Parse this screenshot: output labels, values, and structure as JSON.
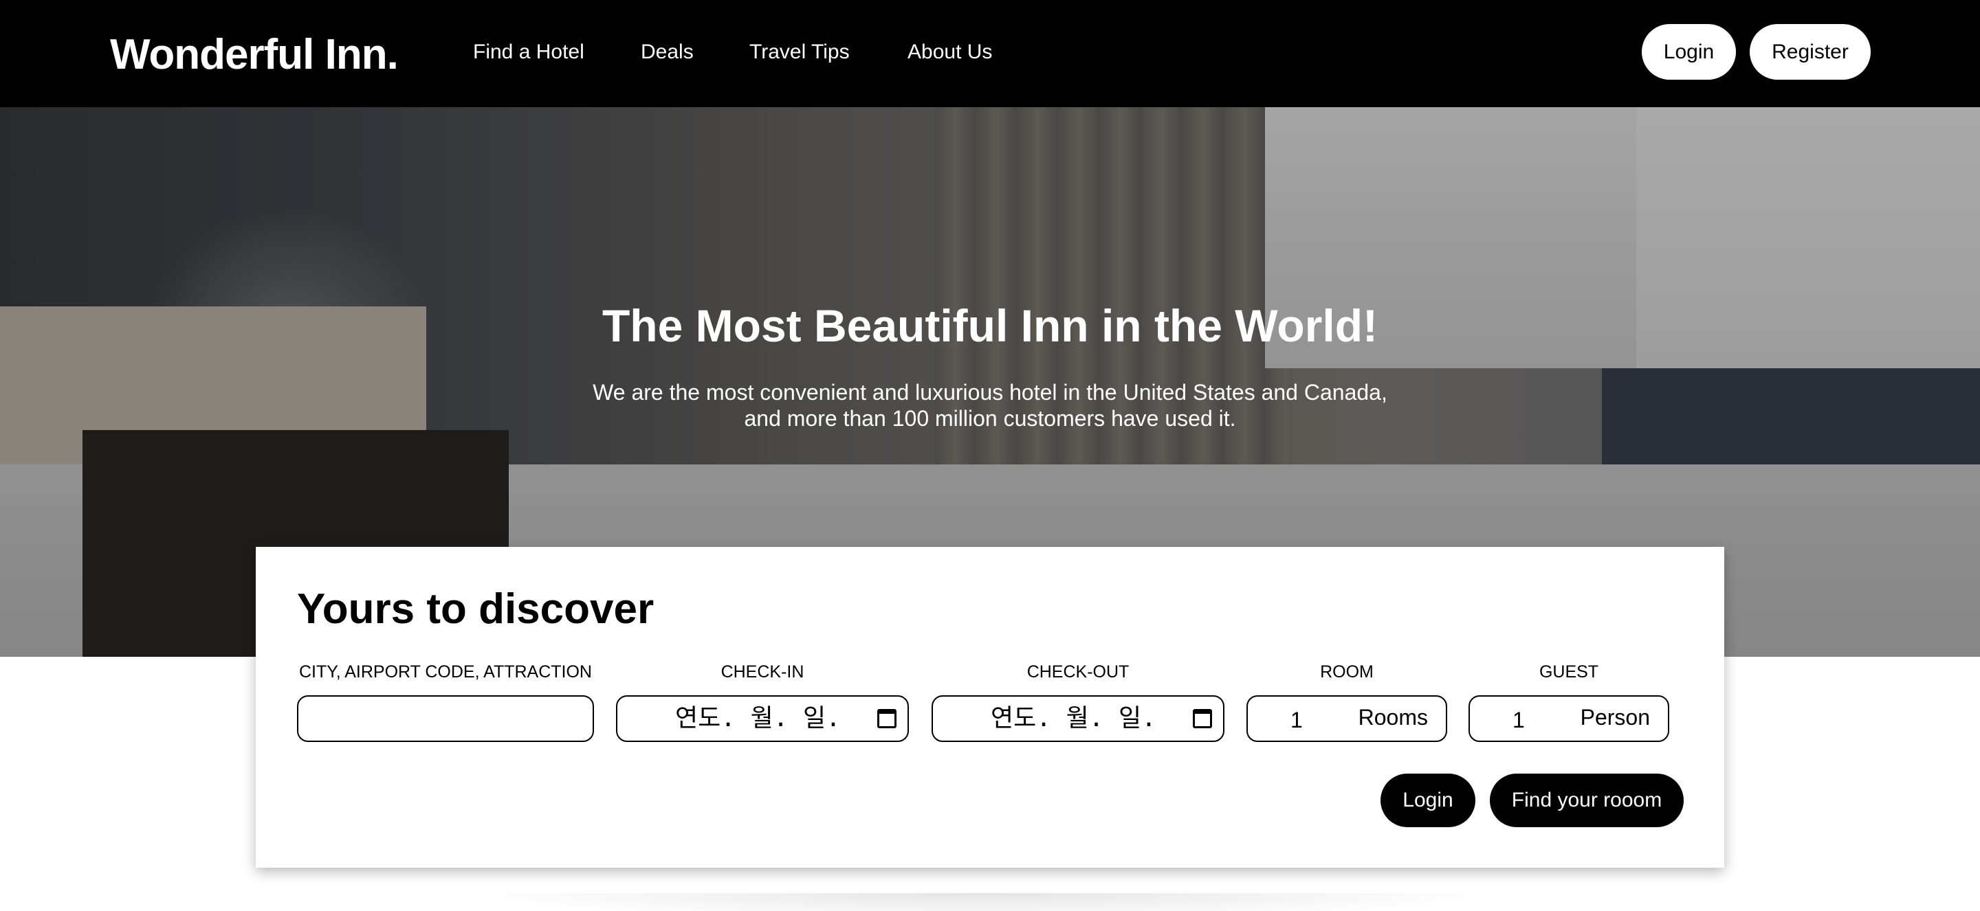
{
  "header": {
    "logo": "Wonderful Inn.",
    "nav": [
      "Find a Hotel",
      "Deals",
      "Travel Tips",
      "About Us"
    ],
    "login_label": "Login",
    "register_label": "Register"
  },
  "hero": {
    "title": "The Most Beautiful Inn in the World!",
    "subtitle": "We are the most convenient and luxurious hotel in the United States and Canada, and more than 100 million customers have used it."
  },
  "search": {
    "title": "Yours to discover",
    "destination_label": "CITY, AIRPORT CODE, ATTRACTION",
    "destination_value": "",
    "checkin_label": "CHECK-IN",
    "checkin_value": "연도. 월. 일.",
    "checkout_label": "CHECK-OUT",
    "checkout_value": "연도. 월. 일.",
    "room_label": "ROOM",
    "room_value": "1",
    "room_unit": "Rooms",
    "guest_label": "GUEST",
    "guest_value": "1",
    "guest_unit": "Person",
    "login_label": "Login",
    "find_label": "Find your rooom"
  }
}
